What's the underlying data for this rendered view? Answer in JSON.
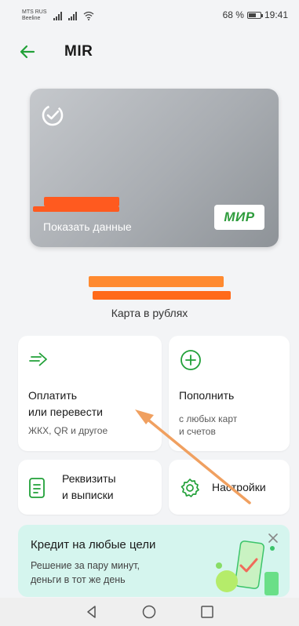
{
  "status_bar": {
    "carrier_primary": "MTS RUS",
    "carrier_secondary": "Beeline",
    "battery_text": "68 %",
    "battery_level": 0.68,
    "time": "19:41"
  },
  "header": {
    "title": "MIR"
  },
  "card": {
    "show_data_label": "Показать данные",
    "brand_logo": "МИР"
  },
  "account": {
    "currency_label": "Карта в рублях"
  },
  "actions": {
    "pay": {
      "title_line1": "Оплатить",
      "title_line2": "или перевести",
      "subtitle": "ЖКХ, QR и другое",
      "icon": "transfer-arrow-icon"
    },
    "topup": {
      "title": "Пополнить",
      "subtitle_line1": "с любых карт",
      "subtitle_line2": "и счетов",
      "icon": "plus-circle-icon"
    },
    "requisites": {
      "title_line1": "Реквизиты",
      "title_line2": "и выписки",
      "icon": "document-icon"
    },
    "settings": {
      "title": "Настройки",
      "icon": "gear-icon"
    }
  },
  "promo": {
    "title": "Кредит на любые цели",
    "subtitle_line1": "Решение за пару минут,",
    "subtitle_line2": "деньги в тот же день"
  },
  "colors": {
    "accent_green": "#21a038",
    "annotation_arrow": "#f0a060",
    "redaction": "#ff6a1a",
    "promo_bg": "#d5f5ee"
  }
}
